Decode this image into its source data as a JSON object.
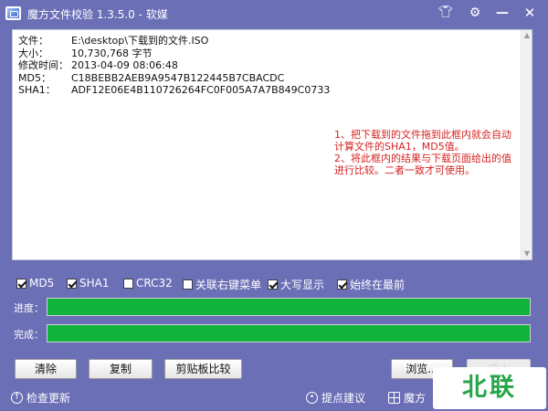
{
  "window": {
    "title": "魔方文件校验 1.3.5.0 - 软媒",
    "icons": [
      "skin-icon",
      "settings-icon",
      "minimize-icon",
      "close-icon"
    ]
  },
  "info": {
    "rows": [
      {
        "key": "文件：",
        "value": "E:\\desktop\\下载到的文件.ISO"
      },
      {
        "key": "大小：",
        "value": "10,730,768 字节"
      },
      {
        "key": "修改时间：",
        "value": "2013-04-09 08:06:48"
      },
      {
        "key": "MD5：",
        "value": "C18BEBB2AEB9A9547B122445B7CBACDC"
      },
      {
        "key": "SHA1：",
        "value": "ADF12E06E4B110726264FC0F005A7A7B849C0733"
      }
    ],
    "hint": [
      "1、把下载到的文件拖到此框内就会自动",
      "计算文件的SHA1，MD5值。",
      "2、将此框内的结果与下载页面给出的值",
      "进行比较。二者一致才可使用。"
    ]
  },
  "options": [
    {
      "label": "MD5",
      "checked": true
    },
    {
      "label": "SHA1",
      "checked": true
    },
    {
      "label": "CRC32",
      "checked": false
    },
    {
      "label": "关联右键菜单",
      "checked": false
    },
    {
      "label": "大写显示",
      "checked": true
    },
    {
      "label": "始终在最前",
      "checked": true
    }
  ],
  "progress": {
    "progress_label": "进度：",
    "progress_value": 1.0,
    "complete_label": "完成：",
    "complete_value": 1.0,
    "fill_color": "#12b33c"
  },
  "buttons": {
    "clear": "清除",
    "copy": "复制",
    "clipboard_compare": "剪贴板比较",
    "browse": "浏览...",
    "stop": "停止"
  },
  "footer": {
    "check_update": "检查更新",
    "suggestion": "提点建议",
    "third": "魔方"
  },
  "watermark": "北联",
  "colors": {
    "background": "#6b6fb6",
    "hint_text": "#d62222",
    "progress_fill": "#12b33c"
  }
}
